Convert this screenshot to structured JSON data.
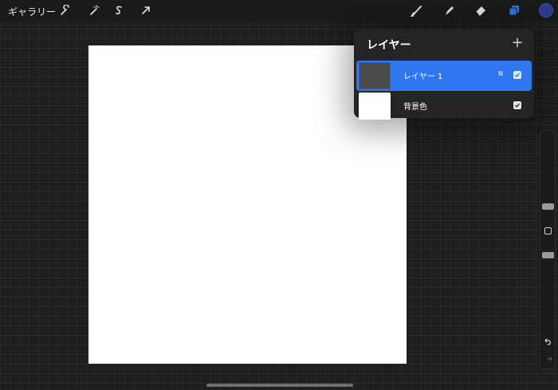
{
  "toolbar": {
    "gallery_label": "ギャラリー",
    "active_color": "#2e3a8c"
  },
  "layers_panel": {
    "title": "レイヤー",
    "add_label": "+",
    "layers": [
      {
        "name": "レイヤー 1",
        "blend_mode": "N",
        "visible": true,
        "selected": true,
        "thumbnail_color": "#4a4a4a"
      },
      {
        "name": "背景色",
        "blend_mode": "",
        "visible": true,
        "selected": false,
        "thumbnail_color": "#ffffff"
      }
    ]
  },
  "colors": {
    "accent": "#2f77f0",
    "canvas": "#ffffff",
    "panel": "#242424"
  }
}
